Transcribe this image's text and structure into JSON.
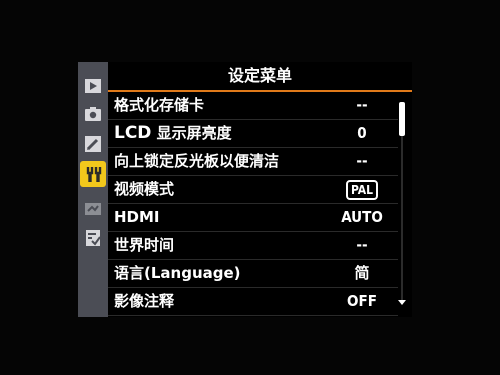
{
  "menu": {
    "title": "设定菜单",
    "items": [
      {
        "label": "格式化存储卡",
        "value": "--"
      },
      {
        "label_abbr": "LCD",
        "label": "显示屏亮度",
        "value": "0"
      },
      {
        "label": "向上锁定反光板以便清洁",
        "value": "--"
      },
      {
        "label": "视频模式",
        "value": "PAL"
      },
      {
        "label": "HDMI",
        "value": "AUTO"
      },
      {
        "label": "世界时间",
        "value": "--"
      },
      {
        "label": "语言(Language)",
        "value": "简"
      },
      {
        "label": "影像注释",
        "value": "OFF"
      }
    ]
  },
  "tabs": [
    {
      "icon": "playback-menu-icon",
      "active": false
    },
    {
      "icon": "shooting-menu-icon",
      "active": false
    },
    {
      "icon": "custom-setting-pencil-icon",
      "active": false
    },
    {
      "icon": "setup-wrench-icon",
      "active": true
    },
    {
      "icon": "retouch-menu-icon",
      "active": false
    },
    {
      "icon": "my-menu-icon",
      "active": false
    }
  ],
  "colors": {
    "tab_column": "#4b4d55",
    "active_tab": "#f2c81c",
    "title_underline": "#e07a1a",
    "text": "#ffffff",
    "background": "#000000"
  }
}
